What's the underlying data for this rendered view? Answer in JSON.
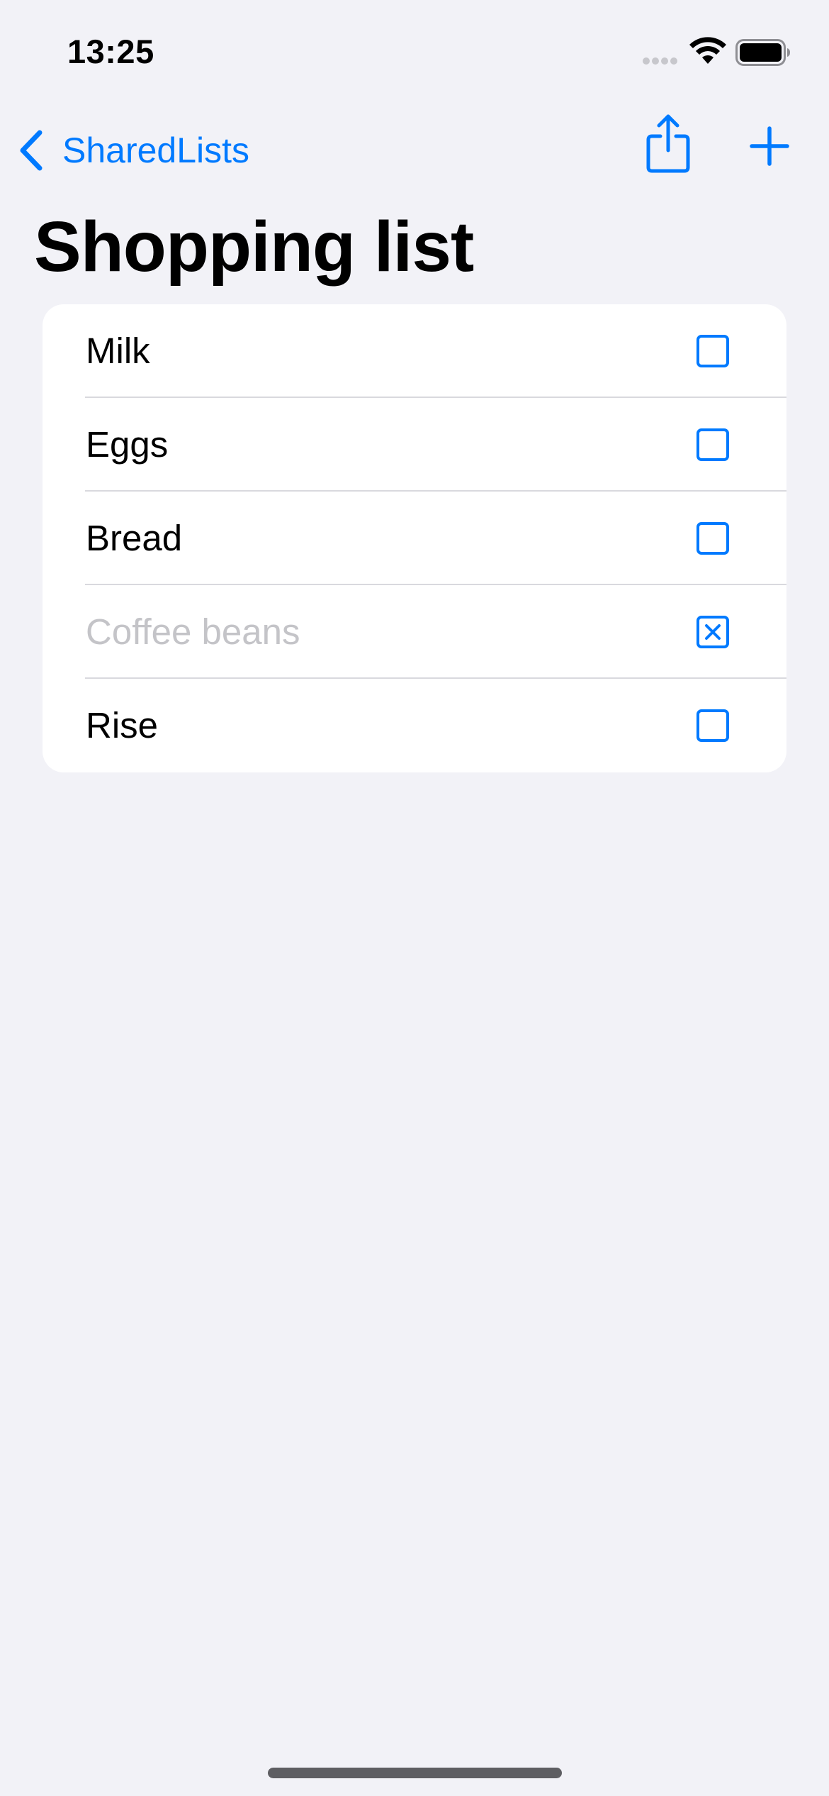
{
  "status_bar": {
    "time": "13:25"
  },
  "nav": {
    "back_label": "SharedLists",
    "share_icon": "share-icon",
    "add_icon": "plus-icon"
  },
  "title": "Shopping list",
  "items": [
    {
      "label": "Milk",
      "checked": false
    },
    {
      "label": "Eggs",
      "checked": false
    },
    {
      "label": "Bread",
      "checked": false
    },
    {
      "label": "Coffee beans",
      "checked": true
    },
    {
      "label": "Rise",
      "checked": false
    }
  ],
  "colors": {
    "accent": "#007aff",
    "background": "#f2f2f7",
    "card": "#ffffff",
    "checked_text": "#c4c4c8",
    "separator": "#d9d9de"
  }
}
